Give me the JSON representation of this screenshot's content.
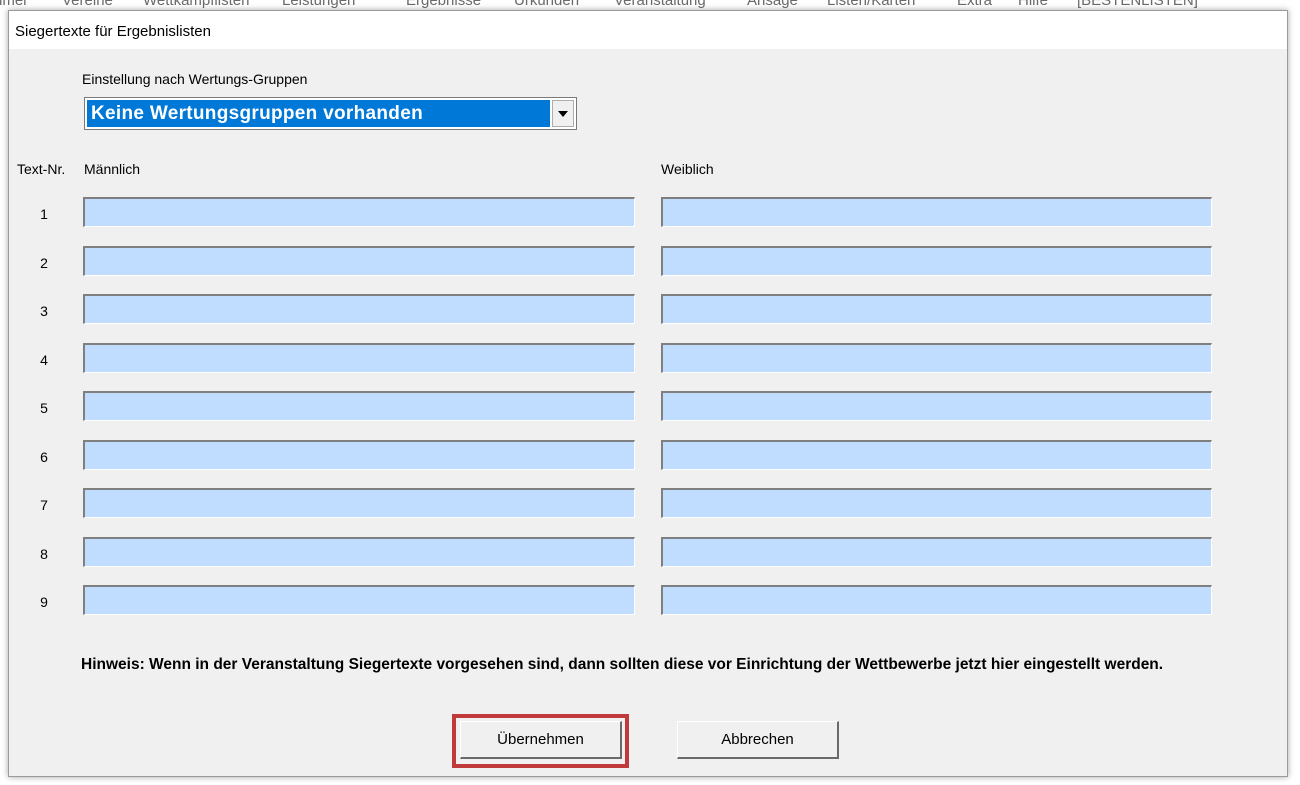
{
  "app_menu": [
    "nmer",
    "Vereine",
    "Wettkampflisten",
    "Leistungen",
    "Ergebnisse",
    "Urkunden",
    "Veranstaltung",
    "Ansage",
    "Listen/Karten",
    "Extra",
    "Hilfe",
    "[BESTENLISTEN]"
  ],
  "dialog": {
    "title": "Siegertexte für Ergebnislisten",
    "group_label": "Einstellung nach Wertungs-Gruppen",
    "group_selected": "Keine Wertungsgruppen vorhanden",
    "col_textnr": "Text-Nr.",
    "col_male": "Männlich",
    "col_female": "Weiblich",
    "rows": [
      {
        "nr": "1",
        "male": "",
        "female": ""
      },
      {
        "nr": "2",
        "male": "",
        "female": ""
      },
      {
        "nr": "3",
        "male": "",
        "female": ""
      },
      {
        "nr": "4",
        "male": "",
        "female": ""
      },
      {
        "nr": "5",
        "male": "",
        "female": ""
      },
      {
        "nr": "6",
        "male": "",
        "female": ""
      },
      {
        "nr": "7",
        "male": "",
        "female": ""
      },
      {
        "nr": "8",
        "male": "",
        "female": ""
      },
      {
        "nr": "9",
        "male": "",
        "female": ""
      }
    ],
    "hint": "Hinweis: Wenn in der Veranstaltung Siegertexte vorgesehen sind, dann sollten diese vor Einrichtung der Wettbewerbe jetzt hier eingestellt werden.",
    "apply_button": "Übernehmen",
    "cancel_button": "Abbrechen",
    "dropdown_icon": "chevron-down-icon"
  },
  "colors": {
    "field_bg": "#c0dcff",
    "selection": "#0078d7",
    "highlight": "#c0393b",
    "dialog_bg": "#f0f0f0"
  }
}
